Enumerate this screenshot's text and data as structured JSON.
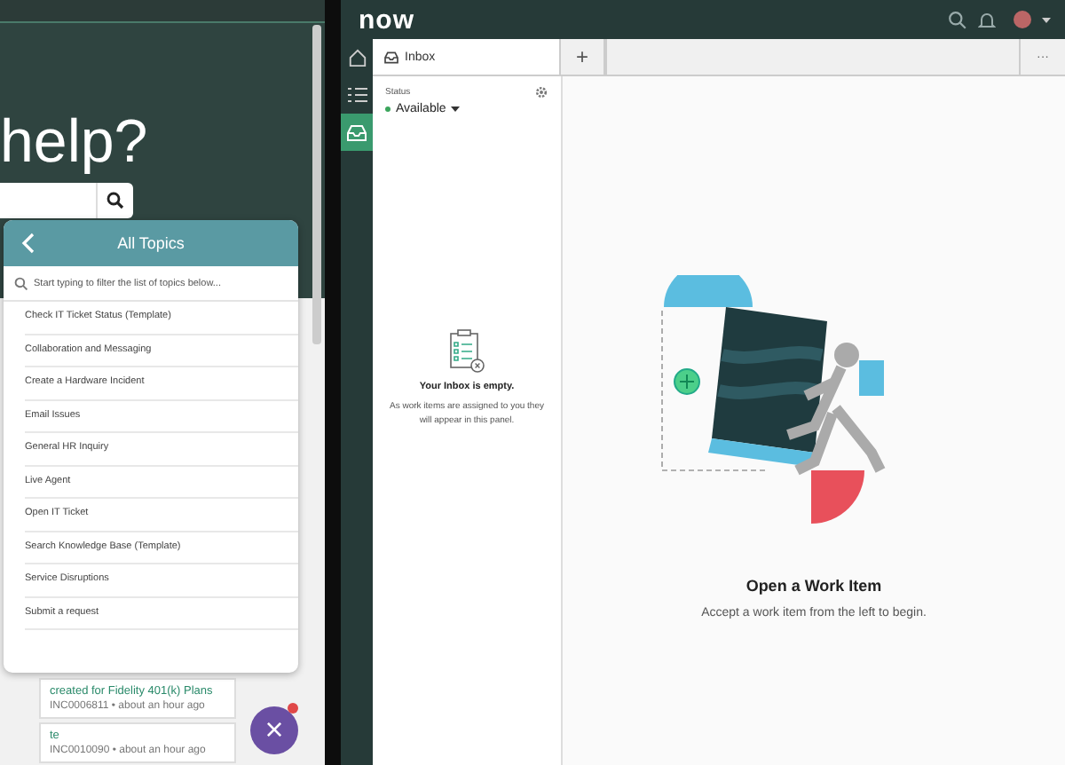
{
  "portal": {
    "heading": "help?",
    "cards": [
      {
        "title": "created for Fidelity 401(k) Plans",
        "meta": "INC0006811 • about an hour ago"
      },
      {
        "title": "te",
        "meta": "INC0010090 • about an hour ago"
      }
    ]
  },
  "topics": {
    "title": "All Topics",
    "placeholder": "Start typing to filter the list of topics below...",
    "items": [
      "Check IT Ticket Status (Template)",
      "Collaboration and Messaging",
      "Create a Hardware Incident",
      "Email Issues",
      "General HR Inquiry",
      "Live Agent",
      "Open IT Ticket",
      "Search Knowledge Base (Template)",
      "Service Disruptions",
      "Submit a request"
    ]
  },
  "chat_button": {
    "label": "×",
    "notification": true
  },
  "workspace": {
    "logo": "now",
    "rail": [
      {
        "kind": "home",
        "selected": false
      },
      {
        "kind": "list",
        "selected": false
      },
      {
        "kind": "inbox",
        "selected": true
      }
    ],
    "tabs": [
      {
        "label": "Inbox",
        "selected": true
      }
    ],
    "add_tab": "+",
    "more": "···",
    "status_label": "Status",
    "status": "Available",
    "empty_title": "Your Inbox is empty.",
    "empty_text": "As work items are assigned to you they will appear in this panel.",
    "main_title": "Open a Work Item",
    "main_text": "Accept a work item from the left to begin."
  }
}
